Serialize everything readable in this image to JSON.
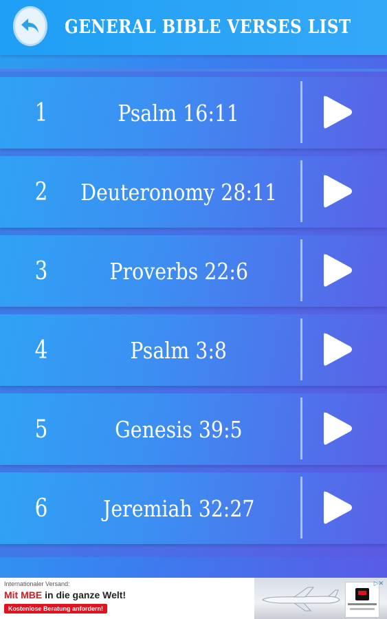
{
  "header": {
    "title": "GENERAL BIBLE VERSES LIST",
    "back_icon": "back-arrow-icon"
  },
  "verses": [
    {
      "number": "1",
      "reference": "Psalm 16:11"
    },
    {
      "number": "2",
      "reference": "Deuteronomy 28:11"
    },
    {
      "number": "3",
      "reference": "Proverbs 22:6"
    },
    {
      "number": "4",
      "reference": "Psalm 3:8"
    },
    {
      "number": "5",
      "reference": "Genesis 39:5"
    },
    {
      "number": "6",
      "reference": "Jeremiah 32:27"
    }
  ],
  "ad": {
    "small_text": "Internationaler Versand:",
    "main_prefix": "Mit MBE",
    "main_suffix": " in die ganze Welt!",
    "cta": "Kostenlose Beratung anfordern!",
    "choices_icon": "ad-choices-icon"
  },
  "colors": {
    "header": "#1e9ff5",
    "row_start": "#2fa2f5",
    "row_end": "#5a62e8",
    "ad_red": "#e0141e"
  }
}
